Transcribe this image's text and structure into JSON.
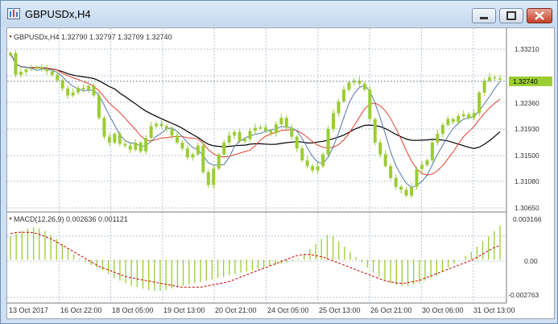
{
  "window": {
    "title": "GBPUSDx,H4",
    "buttons": {
      "minimize": "minimize",
      "maximize": "maximize",
      "close": "close"
    }
  },
  "colors": {
    "bull_candle": "#9acd32",
    "grid": "#b8c4d0",
    "ma_fast": "#5577aa",
    "ma_mid": "#e0402a",
    "ma_slow": "#000000",
    "macd_hist": "#9acd32",
    "macd_signal": "#cc0000",
    "price_tag_bg": "#9acd32"
  },
  "price_panel": {
    "header": "GBPUSDx,H4  1.32790 1.32797 1.32709 1.32740",
    "current_price_tag": "1.32740",
    "yticks": [
      "1.33210",
      "1.32360",
      "1.31930",
      "1.31500",
      "1.31080",
      "1.30650"
    ]
  },
  "macd_panel": {
    "header": "MACD(12,26,9) 0.002636 0.001121",
    "yticks": [
      "0.003166",
      "0.00",
      "-0.002763"
    ]
  },
  "x_axis": {
    "labels": [
      "13 Oct 2017",
      "16 Oct 22:00",
      "18 Oct 05:00",
      "19 Oct 13:00",
      "20 Oct 21:00",
      "24 Oct 05:00",
      "25 Oct 13:00",
      "26 Oct 21:00",
      "30 Oct 06:00",
      "31 Oct 13:00"
    ]
  },
  "chart_data": [
    {
      "type": "candlestick",
      "title": "GBPUSDx,H4",
      "ohlc_last": {
        "open": 1.3279,
        "high": 1.32797,
        "low": 1.32709,
        "close": 1.3274
      },
      "ylim": [
        1.3055,
        1.3345
      ],
      "indicators": [
        "moving average (fast)",
        "moving average (medium)",
        "moving average (slow)"
      ],
      "closes": [
        1.3322,
        1.3285,
        1.329,
        1.3294,
        1.3296,
        1.3298,
        1.3295,
        1.3291,
        1.3285,
        1.3276,
        1.3262,
        1.325,
        1.3255,
        1.3263,
        1.326,
        1.3266,
        1.325,
        1.3212,
        1.318,
        1.317,
        1.3185,
        1.3168,
        1.3165,
        1.3158,
        1.317,
        1.3155,
        1.3178,
        1.3198,
        1.3202,
        1.3198,
        1.3193,
        1.3182,
        1.317,
        1.316,
        1.3145,
        1.315,
        1.3165,
        1.312,
        1.3098,
        1.3126,
        1.315,
        1.317,
        1.3182,
        1.3188,
        1.3172,
        1.3176,
        1.319,
        1.3195,
        1.3196,
        1.319,
        1.3186,
        1.3201,
        1.3212,
        1.3195,
        1.318,
        1.316,
        1.314,
        1.313,
        1.3123,
        1.313,
        1.315,
        1.3193,
        1.322,
        1.324,
        1.326,
        1.3272,
        1.3275,
        1.327,
        1.326,
        1.321,
        1.317,
        1.315,
        1.313,
        1.311,
        1.3095,
        1.309,
        1.308,
        1.3095,
        1.3125,
        1.3132,
        1.314,
        1.317,
        1.3185,
        1.32,
        1.321,
        1.3205,
        1.3215,
        1.3218,
        1.3212,
        1.322,
        1.3255,
        1.3275,
        1.3281,
        1.3279,
        1.3278
      ]
    },
    {
      "type": "bar",
      "title": "MACD(12,26,9)",
      "series": [
        {
          "name": "main",
          "last": 0.002636,
          "values": [
            0.0018,
            0.002,
            0.0022,
            0.0024,
            0.0025,
            0.0024,
            0.0022,
            0.0019,
            0.0016,
            0.0012,
            0.0008,
            0.0004,
            0.0001,
            -0.0002,
            -0.0004,
            -0.0006,
            -0.0008,
            -0.0011,
            -0.0014,
            -0.0016,
            -0.0018,
            -0.002,
            -0.0021,
            -0.0022,
            -0.0023,
            -0.0024,
            -0.0024,
            -0.0023,
            -0.0022,
            -0.0021,
            -0.002,
            -0.0019,
            -0.0018,
            -0.0017,
            -0.0016,
            -0.0015,
            -0.0014,
            -0.0013,
            -0.0012,
            -0.0011,
            -0.001,
            -0.0009,
            -0.0008,
            -0.0007,
            -0.0006,
            -0.0005,
            -0.0004,
            -0.0003,
            -0.0002,
            -0.0001,
            0.0001,
            0.0004,
            0.0008,
            0.0012,
            0.0016,
            0.0019,
            0.0018,
            0.0014,
            0.001,
            0.0006,
            0.0002,
            -0.0002,
            -0.0006,
            -0.001,
            -0.0013,
            -0.0016,
            -0.0018,
            -0.0019,
            -0.002,
            -0.002,
            -0.0019,
            -0.0018,
            -0.0016,
            -0.0014,
            -0.0012,
            -0.0009,
            -0.0006,
            -0.0003,
            0.0,
            0.0003,
            0.0006,
            0.001,
            0.0014,
            0.0018,
            0.0022,
            0.0026
          ]
        },
        {
          "name": "signal",
          "last": 0.001121,
          "values": [
            0.002,
            0.0021,
            0.0021,
            0.0021,
            0.002,
            0.0018,
            0.0016,
            0.0013,
            0.001,
            0.0007,
            0.0004,
            0.0001,
            -0.0002,
            -0.0005,
            -0.0007,
            -0.0009,
            -0.0011,
            -0.0013,
            -0.0014,
            -0.0015,
            -0.0016,
            -0.0017,
            -0.0018,
            -0.0019,
            -0.002,
            -0.0021,
            -0.0021,
            -0.0021,
            -0.0021,
            -0.002,
            -0.0019,
            -0.0018,
            -0.0017,
            -0.0015,
            -0.0013,
            -0.0011,
            -0.0009,
            -0.0007,
            -0.0005,
            -0.0003,
            -0.0001,
            0.0001,
            0.0003,
            0.0004,
            0.0004,
            0.0003,
            0.0002,
            0.0,
            -0.0002,
            -0.0004,
            -0.0006,
            -0.0008,
            -0.001,
            -0.0012,
            -0.0014,
            -0.0016,
            -0.0017,
            -0.0018,
            -0.0018,
            -0.0017,
            -0.0016,
            -0.0014,
            -0.0012,
            -0.001,
            -0.0008,
            -0.0006,
            -0.0004,
            -0.0002,
            0.0,
            0.0003,
            0.0006,
            0.0009,
            0.0011
          ]
        }
      ],
      "ylim": [
        -0.002763,
        0.003166
      ]
    }
  ]
}
